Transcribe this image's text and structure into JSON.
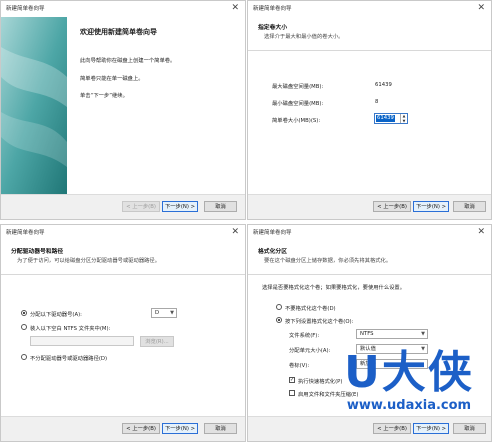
{
  "w1": {
    "title": "新建简单卷向导",
    "welcome_title": "欢迎使用新建简单卷向导",
    "p1": "此向导帮助你在磁盘上创建一个简单卷。",
    "p2": "简单卷只能在单一磁盘上。",
    "p3": "单击“下一步”继续。",
    "back": "< 上一步(B)",
    "next": "下一步(N) >",
    "cancel": "取消"
  },
  "w2": {
    "title": "新建简单卷向导",
    "header_title": "指定卷大小",
    "header_sub": "选择介于最大和最小值的卷大小。",
    "max_label": "最大磁盘空间量(MB):",
    "max_value": "61439",
    "min_label": "最小磁盘空间量(MB):",
    "min_value": "8",
    "size_label": "简单卷大小(MB)(S):",
    "size_value": "61439",
    "back": "< 上一步(B)",
    "next": "下一步(N) >",
    "cancel": "取消"
  },
  "w3": {
    "title": "新建简单卷向导",
    "header_title": "分配驱动器号和路径",
    "header_sub": "为了便于访问，可以给磁盘分区分配驱动器号或驱动器路径。",
    "opt1": "分配以下驱动器号(A):",
    "drive_letter": "D",
    "opt2": "装入以下空白 NTFS 文件夹中(M):",
    "browse": "浏览(R)...",
    "opt3": "不分配驱动器号或驱动器路径(D)",
    "back": "< 上一步(B)",
    "next": "下一步(N) >",
    "cancel": "取消"
  },
  "w4": {
    "title": "新建简单卷向导",
    "header_title": "格式化分区",
    "header_sub": "要在这个磁盘分区上储存数据，你必须先将其格式化。",
    "intro": "选择是否要格式化这个卷；如果要格式化，要使用什么设置。",
    "opt_noformat": "不要格式化这个卷(D)",
    "opt_format": "按下列设置格式化这个卷(O):",
    "fs_label": "文件系统(F):",
    "fs_value": "NTFS",
    "alloc_label": "分配单元大小(A):",
    "alloc_value": "默认值",
    "vol_label": "卷标(V):",
    "vol_value": "新加卷",
    "quick_format": "执行快速格式化(P)",
    "compress": "启用文件和文件夹压缩(E)",
    "back": "< 上一步(B)",
    "next": "下一步(N) >",
    "cancel": "取消"
  },
  "watermark": {
    "big": "U大侠",
    "url": "www.udaxia.com",
    "color": "#1c5fc7"
  }
}
